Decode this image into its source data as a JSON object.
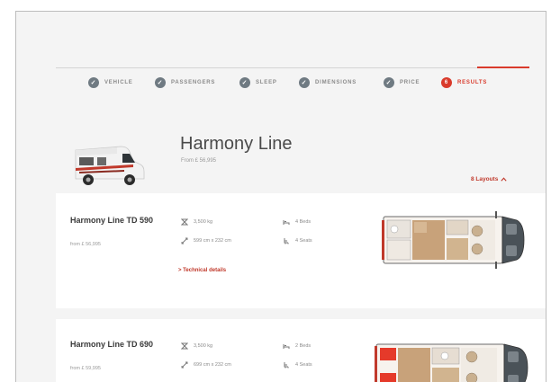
{
  "steps": [
    {
      "label": "VEHICLE",
      "state": "done"
    },
    {
      "label": "PASSENGERS",
      "state": "done"
    },
    {
      "label": "SLEEP",
      "state": "done"
    },
    {
      "label": "DIMENSIONS",
      "state": "done"
    },
    {
      "label": "PRICE",
      "state": "done"
    },
    {
      "label": "RESULTS",
      "state": "active",
      "number": "6"
    }
  ],
  "header": {
    "title": "Harmony Line",
    "from_price": "From £ 56,995",
    "layouts_link": "8 Layouts"
  },
  "cards": [
    {
      "name": "Harmony Line TD 590",
      "price": "from £ 56,995",
      "weight": "3,500 kg",
      "dimensions": "599 cm x 232 cm",
      "beds": "4 Beds",
      "seats": "4 Seats",
      "tech_link": "> Technical details"
    },
    {
      "name": "Harmony Line TD 690",
      "price": "from £ 59,995",
      "weight": "3,500 kg",
      "dimensions": "699 cm x 232 cm",
      "beds": "2 Beds",
      "seats": "4 Seats"
    }
  ],
  "colors": {
    "accent": "#d93a2b",
    "done_dot": "#6f7a82",
    "page_bg": "#f4f4f4"
  }
}
